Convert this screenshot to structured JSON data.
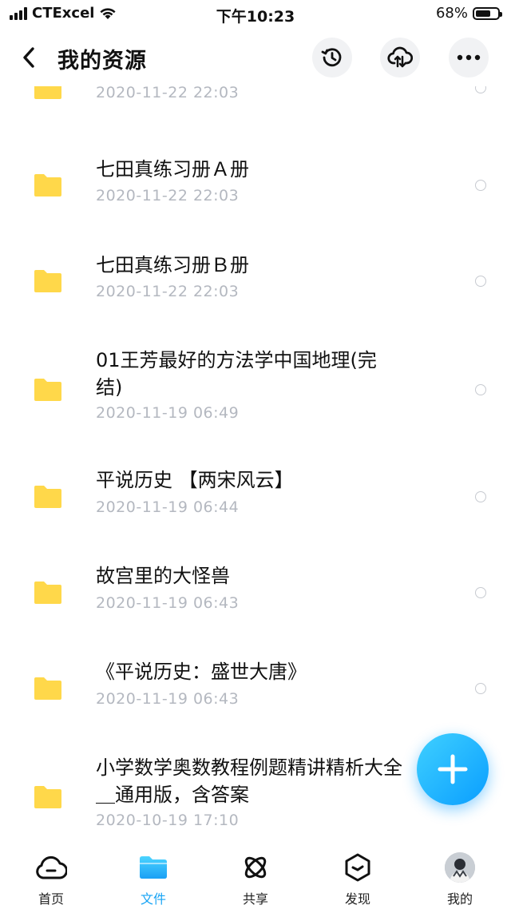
{
  "status_bar": {
    "carrier": "CTExcel",
    "time": "下午10:23",
    "battery": "68%",
    "battery_level": 0.68
  },
  "header": {
    "title": "我的资源",
    "icons": [
      "back-arrow-icon",
      "history-icon",
      "cloud-sync-icon",
      "more-icon"
    ]
  },
  "files": [
    {
      "name": "",
      "date": "2020-11-22 22:03"
    },
    {
      "name": "七田真练习册Ａ册",
      "date": "2020-11-22 22:03"
    },
    {
      "name": "七田真练习册Ｂ册",
      "date": "2020-11-22 22:03"
    },
    {
      "name": "01王芳最好的方法学中国地理(完结)",
      "date": "2020-11-19 06:49"
    },
    {
      "name": "平说历史 【两宋风云】",
      "date": "2020-11-19 06:44"
    },
    {
      "name": "故宫里的大怪兽",
      "date": "2020-11-19 06:43"
    },
    {
      "name": "《平说历史：盛世大唐》",
      "date": "2020-11-19 06:43"
    },
    {
      "name": "小学数学奥数教程例题精讲精析大全＿通用版，含答案",
      "date": "2020-10-19 17:10"
    }
  ],
  "fab": {
    "icon": "plus-icon"
  },
  "bottom_nav": {
    "items": [
      {
        "label": "首页",
        "icon": "cloud-home-icon",
        "active": false
      },
      {
        "label": "文件",
        "icon": "folder-icon",
        "active": true
      },
      {
        "label": "共享",
        "icon": "orbit-share-icon",
        "active": false
      },
      {
        "label": "发现",
        "icon": "discover-box-icon",
        "active": false
      },
      {
        "label": "我的",
        "icon": "avatar",
        "active": false
      }
    ]
  },
  "colors": {
    "accent": "#17a4f5",
    "folder": "#ffd84a",
    "date": "#b4b8c0",
    "fab": "#0a9eff"
  }
}
